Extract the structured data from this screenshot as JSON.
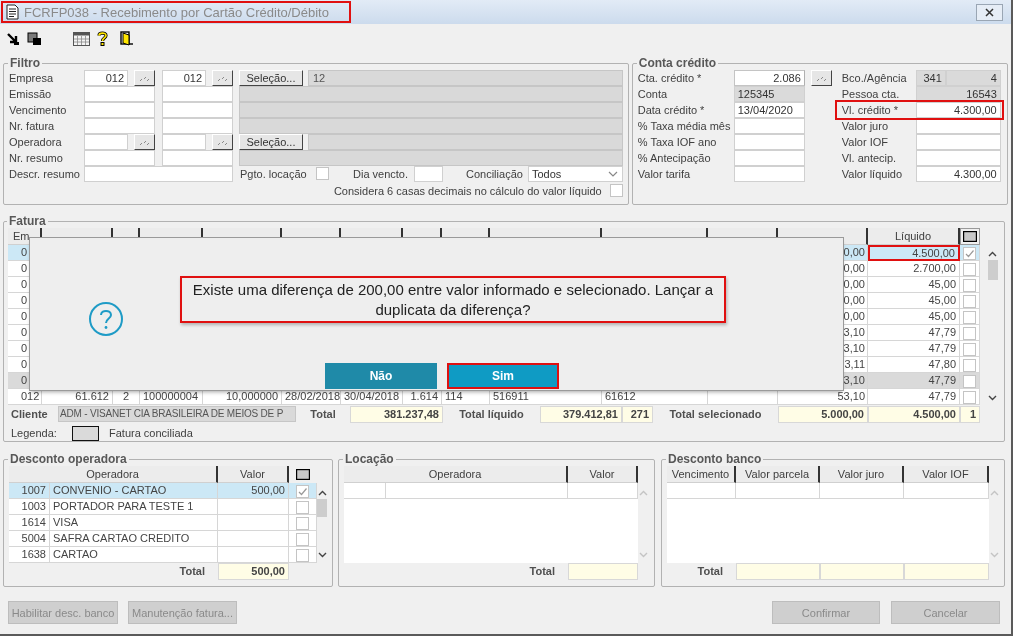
{
  "window": {
    "title": "FCRFP038 - Recebimento por Cartão Crédito/Débito",
    "highlighted": true
  },
  "filter": {
    "title": "Filtro",
    "rows": [
      {
        "kind": "range",
        "label": "Empresa",
        "fields": [
          {
            "value": "012",
            "lookup": true
          },
          {
            "value": "012",
            "lookup": true
          }
        ],
        "selection_button": "Seleção...",
        "display": "12"
      },
      {
        "kind": "range",
        "label": "Emissão",
        "fields": [
          {
            "lookup": false
          },
          {
            "lookup": false
          }
        ]
      },
      {
        "kind": "range",
        "label": "Vencimento",
        "fields": [
          {
            "lookup": false
          },
          {
            "lookup": false
          }
        ]
      },
      {
        "kind": "range",
        "label": "Nr. fatura",
        "fields": [
          {
            "lookup": false
          },
          {
            "lookup": false
          }
        ]
      },
      {
        "kind": "range",
        "label": "Operadora",
        "fields": [
          {
            "lookup": true
          },
          {
            "lookup": true
          }
        ],
        "selection_button": "Seleção..."
      },
      {
        "kind": "range",
        "label": "Nr. resumo",
        "fields": [
          {
            "lookup": false
          },
          {
            "lookup": false
          }
        ]
      },
      {
        "kind": "description",
        "label": "Descr. resumo",
        "location_payment": {
          "label": "Pgto. locação",
          "checked": false
        },
        "due_day": {
          "label": "Dia vencto."
        },
        "reconciliation": {
          "label": "Conciliação",
          "value": "Todos"
        }
      }
    ],
    "decimals_option": {
      "label": "Considera 6 casas decimais no cálculo do valor líquido",
      "checked": false
    }
  },
  "credit_account": {
    "title": "Conta crédito",
    "left": [
      {
        "label": "Cta. crédito *",
        "fields": [
          {
            "kind": "number",
            "readonly": false,
            "value": "2.086"
          }
        ],
        "lookup": true
      },
      {
        "label": "Conta",
        "fields": [
          {
            "kind": "text",
            "readonly": true,
            "value": "125345"
          }
        ],
        "lookup": false
      },
      {
        "label": "Data crédito *",
        "fields": [
          {
            "kind": "text",
            "readonly": false,
            "value": "13/04/2020"
          }
        ],
        "lookup": false
      },
      {
        "label": "% Taxa média mês",
        "fields": [
          {
            "kind": "number",
            "readonly": false
          }
        ],
        "lookup": false
      },
      {
        "label": "% Taxa IOF ano",
        "fields": [
          {
            "kind": "number",
            "readonly": false
          }
        ],
        "lookup": false
      },
      {
        "label": "% Antecipação",
        "fields": [
          {
            "kind": "number",
            "readonly": false
          }
        ],
        "lookup": false
      },
      {
        "label": "Valor tarifa",
        "fields": [
          {
            "kind": "number",
            "readonly": false
          }
        ],
        "lookup": false
      }
    ],
    "right": [
      {
        "label": "Bco./Agência",
        "fields": [
          {
            "kind": "number",
            "readonly": true,
            "value": "341"
          },
          {
            "kind": "number",
            "readonly": true,
            "value": "4"
          }
        ],
        "highlighted": false
      },
      {
        "label": "Pessoa cta.",
        "fields": [
          {
            "kind": "number",
            "readonly": true,
            "value": "16543"
          }
        ],
        "highlighted": false
      },
      {
        "label": "Vl. crédito *",
        "fields": [
          {
            "kind": "number",
            "readonly": false,
            "value": "4.300,00"
          }
        ],
        "highlighted": true
      },
      {
        "label": "Valor juro",
        "fields": [
          {
            "kind": "number",
            "readonly": false
          }
        ],
        "highlighted": false
      },
      {
        "label": "Valor IOF",
        "fields": [
          {
            "kind": "number",
            "readonly": false
          }
        ],
        "highlighted": false
      },
      {
        "label": "Vl. antecip.",
        "fields": [
          {
            "kind": "number",
            "readonly": false
          }
        ],
        "highlighted": false
      },
      {
        "label": "Valor líquido",
        "fields": [
          {
            "kind": "number",
            "readonly": false,
            "value": "4.300,00"
          }
        ],
        "highlighted": false
      }
    ]
  },
  "invoices": {
    "title": "Fatura",
    "header": {
      "column_1": "Em",
      "column_14": "Líquido"
    },
    "rows": [
      {
        "cells": {
          "column_1": "0",
          "column_13": "0,00",
          "column_14": "4.500,00"
        },
        "checked": true,
        "selected": true,
        "reconciled": false,
        "highlighted": true
      },
      {
        "cells": {
          "column_1": "0",
          "column_13": "0,00",
          "column_14": "2.700,00"
        },
        "checked": false,
        "selected": false,
        "reconciled": false,
        "highlighted": false
      },
      {
        "cells": {
          "column_1": "0",
          "column_13": "0,00",
          "column_14": "45,00"
        },
        "checked": false,
        "selected": false,
        "reconciled": false,
        "highlighted": false
      },
      {
        "cells": {
          "column_1": "0",
          "column_13": "0,00",
          "column_14": "45,00"
        },
        "checked": false,
        "selected": false,
        "reconciled": false,
        "highlighted": false
      },
      {
        "cells": {
          "column_1": "0",
          "column_13": "0,00",
          "column_14": "45,00"
        },
        "checked": false,
        "selected": false,
        "reconciled": false,
        "highlighted": false
      },
      {
        "cells": {
          "column_1": "0",
          "column_13": "3,10",
          "column_14": "47,79"
        },
        "checked": false,
        "selected": false,
        "reconciled": false,
        "highlighted": false
      },
      {
        "cells": {
          "column_1": "0",
          "column_13": "3,10",
          "column_14": "47,79"
        },
        "checked": false,
        "selected": false,
        "reconciled": false,
        "highlighted": false
      },
      {
        "cells": {
          "column_1": "0",
          "column_13": "3,11",
          "column_14": "47,80"
        },
        "checked": false,
        "selected": false,
        "reconciled": false,
        "highlighted": false
      },
      {
        "cells": {
          "column_1": "0",
          "column_13": "3,10",
          "column_14": "47,79"
        },
        "checked": false,
        "selected": false,
        "reconciled": true,
        "highlighted": false
      },
      {
        "cells": {
          "column_1": "012",
          "column_2": "61.612",
          "column_3": "2",
          "column_4": "100000004",
          "column_5": "10,000000",
          "column_6": "28/02/2018",
          "column_7": "30/04/2018",
          "column_8": "1.614",
          "column_9": "114",
          "column_10": "516911",
          "column_11": "61612",
          "column_13": "53,10",
          "column_14": "47,79"
        },
        "checked": false,
        "selected": false,
        "reconciled": false,
        "highlighted": false
      }
    ],
    "totals": {
      "client_label": "Cliente",
      "client": "ADM - VISANET CIA BRASILEIRA DE MEIOS DE P",
      "total_label": "Total",
      "total": "381.237,48",
      "net_label": "Total líquido",
      "net": "379.412,81",
      "count": "271",
      "selected_label": "Total selecionado",
      "selected_total": "5.000,00",
      "selected_net": "4.500,00",
      "selected_count": "1"
    },
    "legend": {
      "label": "Legenda:",
      "item": "Fatura conciliada"
    }
  },
  "dialog": {
    "message": "Existe uma diferença de 200,00 entre valor informado e selecionado. Lançar a duplicata da diferença?",
    "message_highlighted": true,
    "buttons": [
      {
        "label": "Não",
        "focused": false,
        "highlighted": false
      },
      {
        "label": "Sim",
        "focused": true,
        "highlighted": true
      }
    ]
  },
  "operator_discount": {
    "title": "Desconto operadora",
    "columns": [
      "Operadora",
      "Valor"
    ],
    "rows": [
      {
        "code": "1007",
        "name": "CONVENIO - CARTAO",
        "value": "500,00",
        "checked": true,
        "selected": true
      },
      {
        "code": "1003",
        "name": "PORTADOR PARA TESTE 1",
        "checked": false,
        "selected": false
      },
      {
        "code": "1614",
        "name": "VISA",
        "checked": false,
        "selected": false
      },
      {
        "code": "5004",
        "name": "SAFRA CARTAO CREDITO",
        "checked": false,
        "selected": false
      },
      {
        "code": "1638",
        "name": "CARTAO",
        "checked": false,
        "selected": false
      }
    ],
    "total_label": "Total",
    "total": "500,00"
  },
  "location": {
    "title": "Locação",
    "columns": [
      "Operadora",
      "Valor"
    ],
    "total_label": "Total"
  },
  "bank_discount": {
    "title": "Desconto banco",
    "columns": [
      "Vencimento",
      "Valor parcela",
      "Valor juro",
      "Valor IOF"
    ],
    "total_label": "Total"
  },
  "left_buttons": [
    {
      "label": "Habilitar desc. banco",
      "disabled": true
    },
    {
      "label": "Manutenção fatura...",
      "disabled": true
    }
  ],
  "right_buttons": [
    {
      "label": "Confirmar",
      "disabled": true
    },
    {
      "label": "Cancelar",
      "disabled": true
    }
  ]
}
